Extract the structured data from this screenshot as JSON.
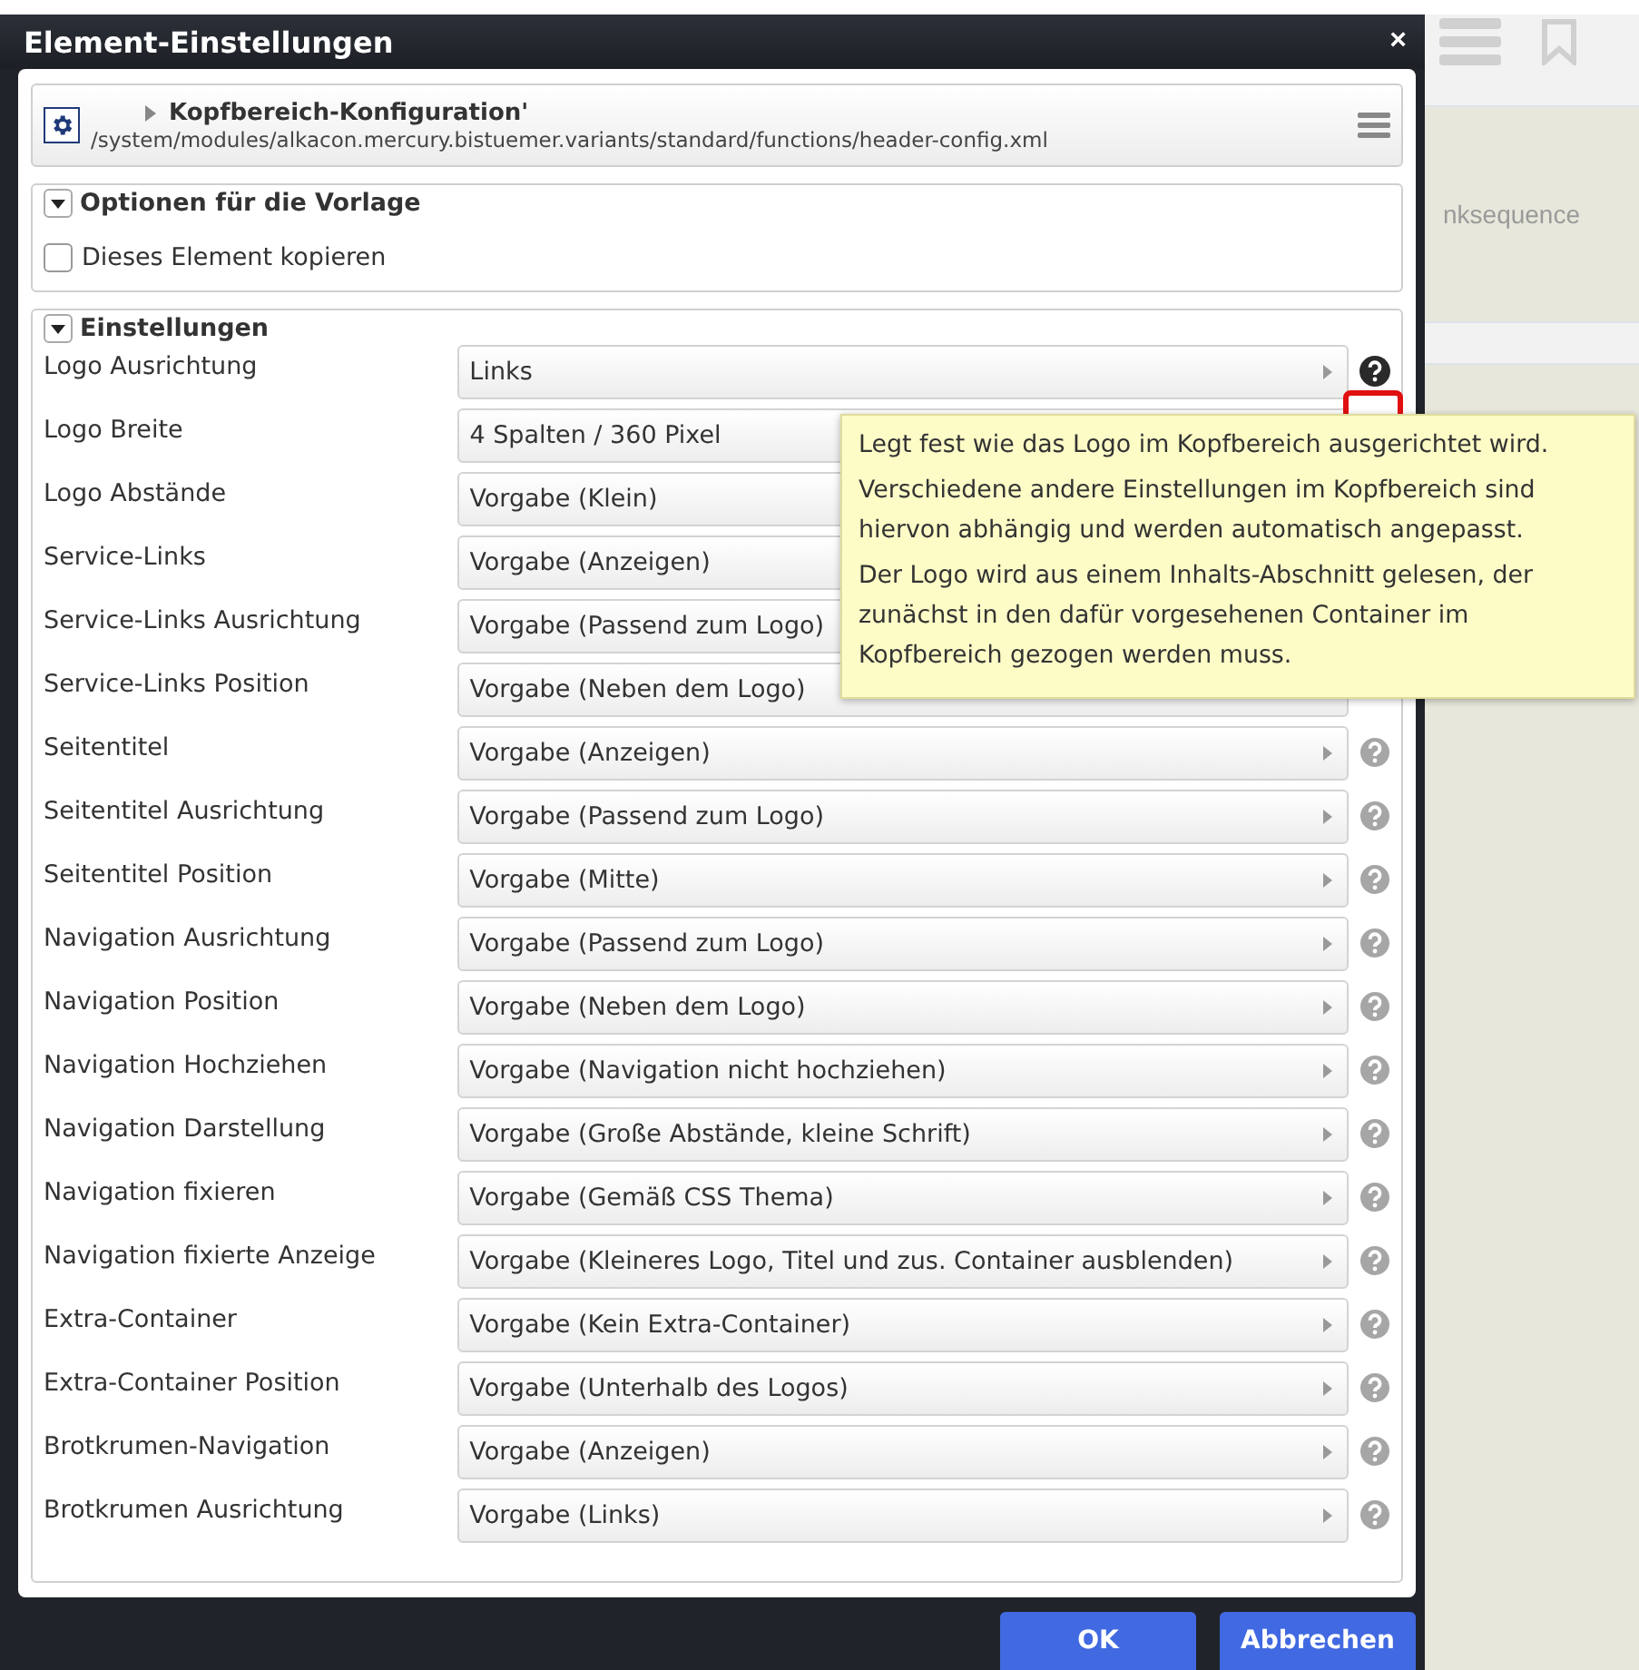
{
  "window": {
    "title": "Element-Einstellungen",
    "close": "×"
  },
  "element": {
    "title": "Kopfbereich-Konfiguration'",
    "path": "/system/modules/alkacon.mercury.bistuemer.variants/standard/functions/header-config.xml"
  },
  "template_options": {
    "legend": "Optionen für die Vorlage",
    "expanded": true,
    "checkbox": {
      "label": "Dieses Element kopieren",
      "checked": false
    }
  },
  "settings": {
    "legend": "Einstellungen",
    "expanded": true,
    "rows": [
      {
        "label": "Logo Ausrichtung",
        "value": "Links",
        "help_shown": true,
        "help_active": true
      },
      {
        "label": "Logo Breite",
        "value": "4 Spalten / 360 Pixel"
      },
      {
        "label": "Logo Abstände",
        "value": "Vorgabe (Klein)"
      },
      {
        "label": "Service-Links",
        "value": "Vorgabe (Anzeigen)"
      },
      {
        "label": "Service-Links Ausrichtung",
        "value": "Vorgabe (Passend zum Logo)"
      },
      {
        "label": "Service-Links Position",
        "value": "Vorgabe (Neben dem Logo)"
      },
      {
        "label": "Seitentitel",
        "value": "Vorgabe (Anzeigen)",
        "help_shown": true,
        "help_active": false
      },
      {
        "label": "Seitentitel Ausrichtung",
        "value": "Vorgabe (Passend zum Logo)",
        "help_shown": true,
        "help_active": false
      },
      {
        "label": "Seitentitel Position",
        "value": "Vorgabe (Mitte)",
        "help_shown": true,
        "help_active": false
      },
      {
        "label": "Navigation Ausrichtung",
        "value": "Vorgabe (Passend zum Logo)",
        "help_shown": true,
        "help_active": false
      },
      {
        "label": "Navigation Position",
        "value": "Vorgabe (Neben dem Logo)",
        "help_shown": true,
        "help_active": false
      },
      {
        "label": "Navigation Hochziehen",
        "value": "Vorgabe (Navigation nicht hochziehen)",
        "help_shown": true,
        "help_active": false
      },
      {
        "label": "Navigation Darstellung",
        "value": "Vorgabe (Große Abstände, kleine Schrift)",
        "help_shown": true,
        "help_active": false
      },
      {
        "label": "Navigation fixieren",
        "value": "Vorgabe (Gemäß CSS Thema)",
        "help_shown": true,
        "help_active": false
      },
      {
        "label": "Navigation fixierte Anzeige",
        "value": "Vorgabe (Kleineres Logo, Titel und zus. Container ausblenden)",
        "help_shown": true,
        "help_active": false
      },
      {
        "label": "Extra-Container",
        "value": "Vorgabe (Kein Extra-Container)",
        "help_shown": true,
        "help_active": false
      },
      {
        "label": "Extra-Container Position",
        "value": "Vorgabe (Unterhalb des Logos)",
        "help_shown": true,
        "help_active": false
      },
      {
        "label": "Brotkrumen-Navigation",
        "value": "Vorgabe (Anzeigen)",
        "help_shown": true,
        "help_active": false
      },
      {
        "label": "Brotkrumen Ausrichtung",
        "value": "Vorgabe (Links)",
        "help_shown": true,
        "help_active": false
      }
    ]
  },
  "tooltip": {
    "paragraphs": [
      "Legt fest wie das Logo im Kopfbereich ausgerichtet wird.",
      "Verschiedene andere Einstellungen im Kopfbereich sind hiervon abhängig und werden automatisch angepasst.",
      "Der Logo wird aus einem Inhalts-Abschnitt gelesen, der zunächst in den dafür vorgesehenen Container im Kopfbereich gezogen werden muss."
    ]
  },
  "buttons": [
    "OK",
    "Abbrechen"
  ],
  "background_page": {
    "text": "nksequence"
  }
}
